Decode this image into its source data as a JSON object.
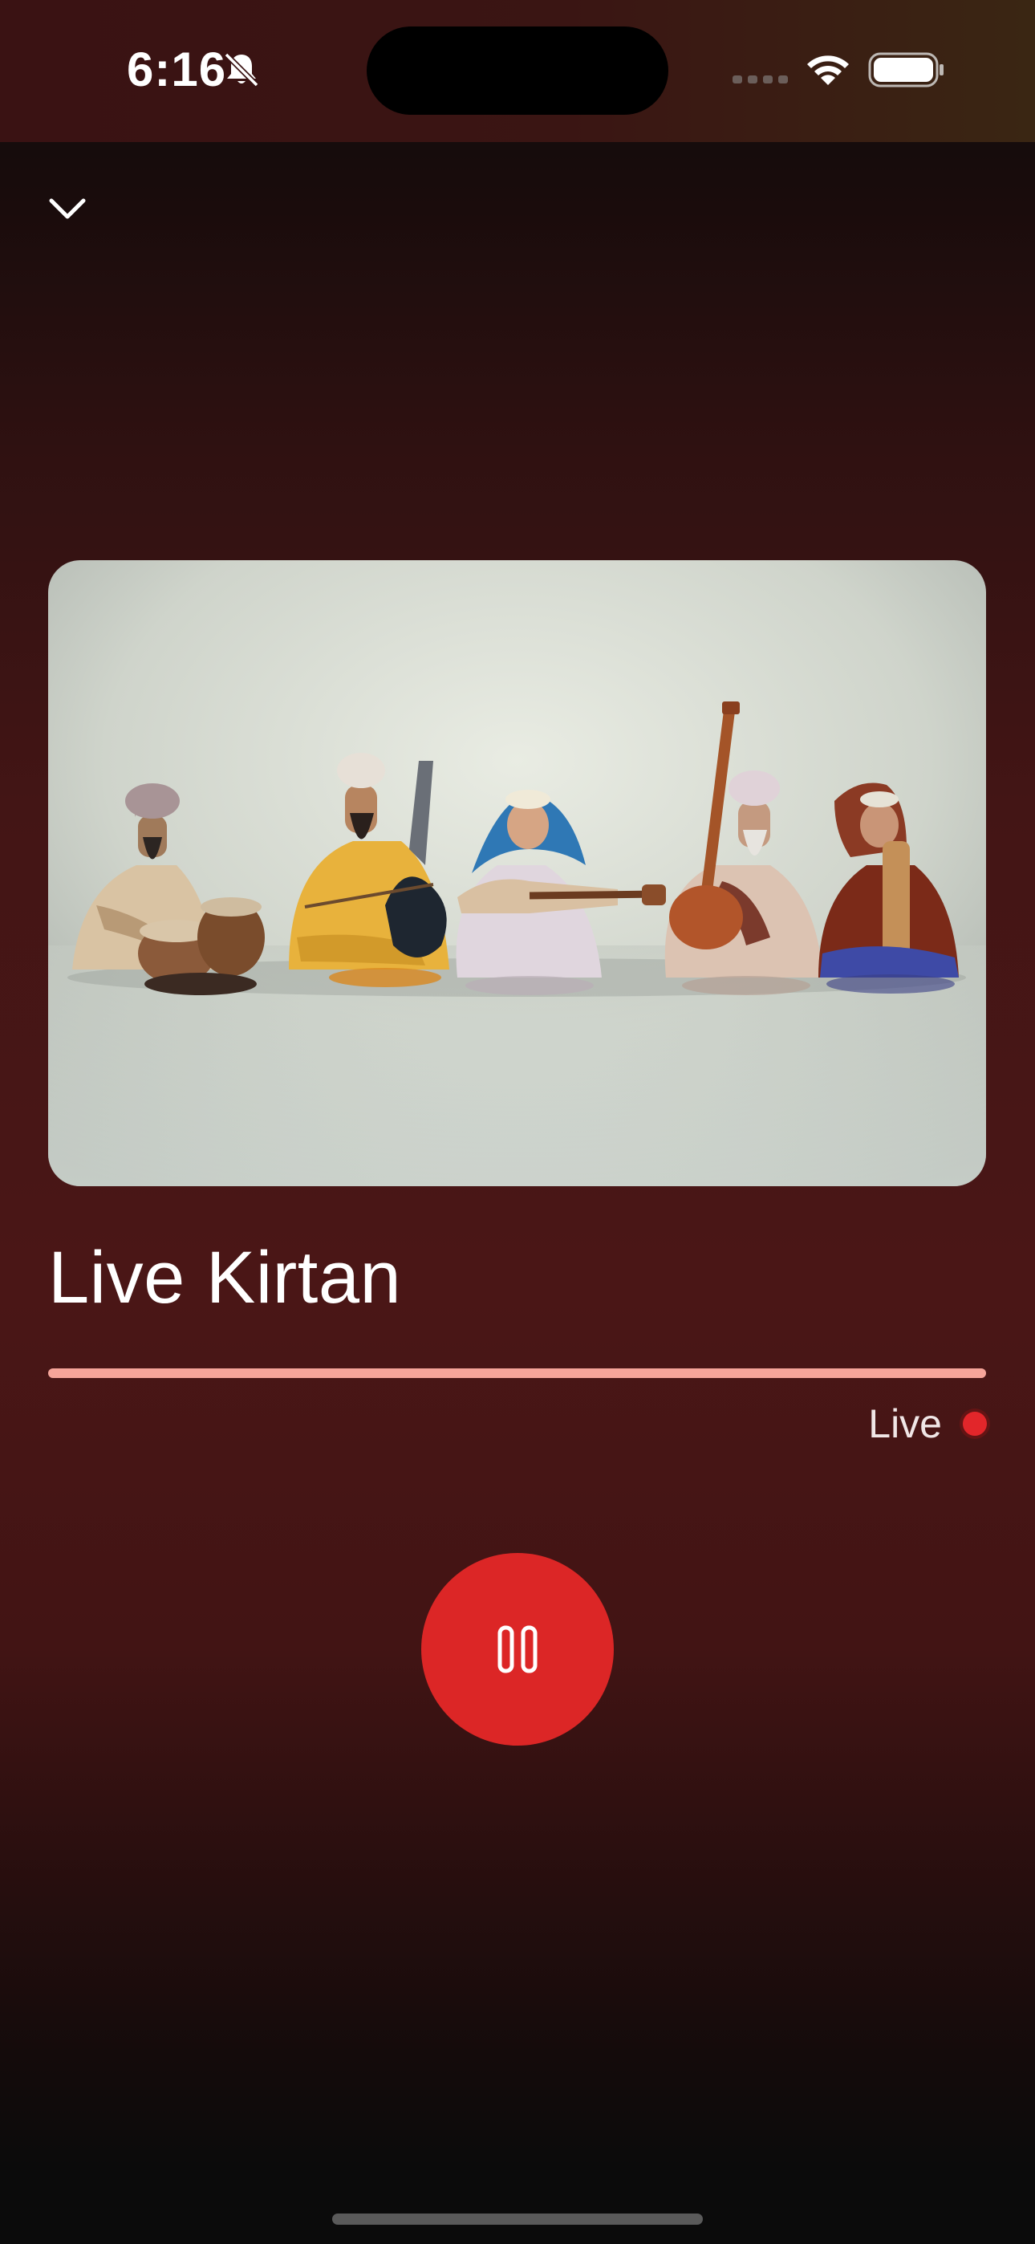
{
  "status_bar": {
    "time": "6:16",
    "icons": [
      "bell-slash-icon",
      "cellular-signal-icon",
      "wifi-icon",
      "battery-icon"
    ]
  },
  "header": {
    "collapse_icon": "chevron-down-icon"
  },
  "player": {
    "artwork_icon": "kirtan-musicians-illustration",
    "title": "Live Kirtan",
    "progress_fraction": 1.0,
    "live_label": "Live",
    "pause_icon": "pause-icon"
  },
  "colors": {
    "accent": "#dc2626",
    "progress": "#f6a59a",
    "live_dot": "#e2262a",
    "background_top": "#0c0c0c",
    "background_mid": "#4a1616"
  }
}
